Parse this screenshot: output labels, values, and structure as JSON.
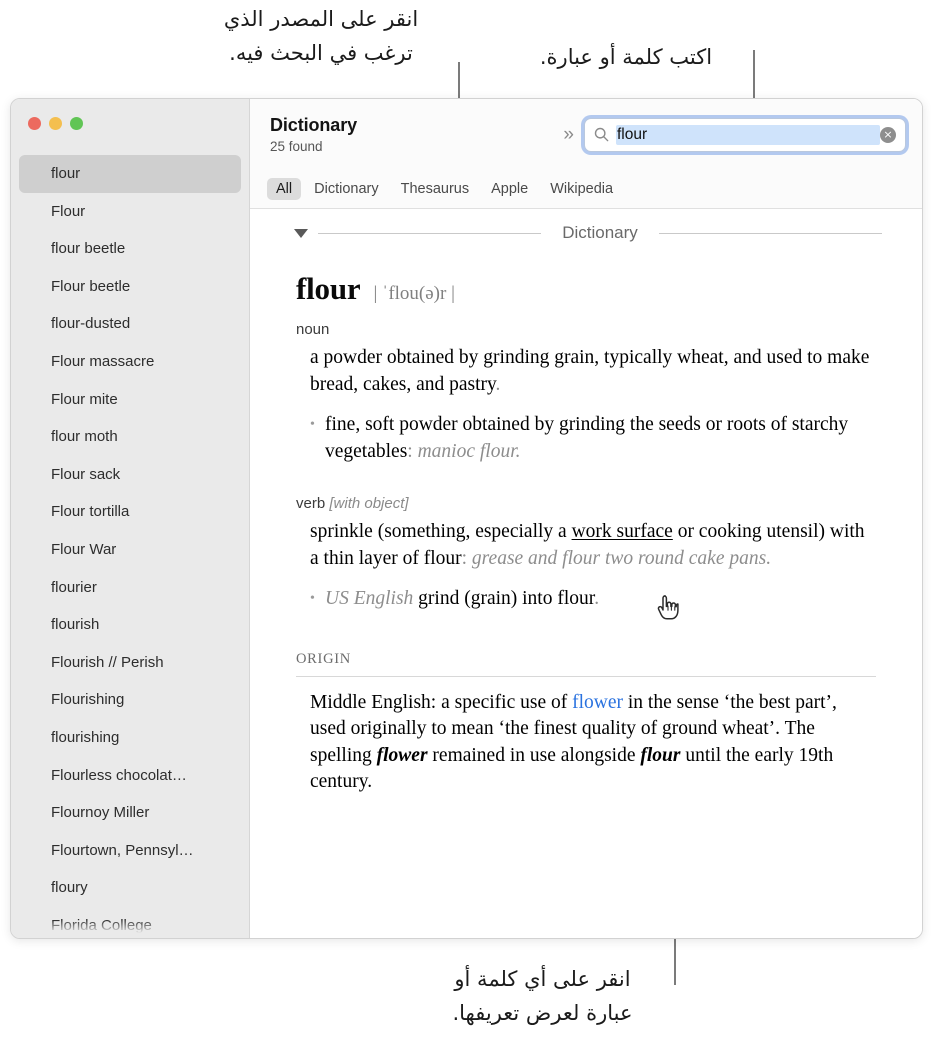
{
  "callouts": {
    "source": "انقر على المصدر الذي\nترغب في البحث فيه.",
    "type": "اكتب كلمة أو عبارة.",
    "click": "انقر على أي كلمة أو\nعبارة لعرض تعريفها."
  },
  "window": {
    "traffic_lights": {
      "close_label": "close-window",
      "minimize_label": "minimize-window",
      "maximize_label": "maximize-window",
      "close_color": "#EC6A5F",
      "minimize_color": "#F4BF4F",
      "maximize_color": "#61C555"
    }
  },
  "toolbar": {
    "app_title": "Dictionary",
    "found_count": "25 found",
    "overflow_chevrons": "»",
    "search": {
      "icon": "search-icon",
      "value": "flour",
      "placeholder": "Search",
      "clear_icon": "×",
      "selection_color": "#CFE3FB",
      "focus_ring_color": "#78A0E6"
    }
  },
  "tabs": [
    {
      "label": "All",
      "active": true
    },
    {
      "label": "Dictionary",
      "active": false
    },
    {
      "label": "Thesaurus",
      "active": false
    },
    {
      "label": "Apple",
      "active": false
    },
    {
      "label": "Wikipedia",
      "active": false
    }
  ],
  "sidebar": {
    "items": [
      {
        "label": "flour",
        "selected": true
      },
      {
        "label": "Flour",
        "selected": false
      },
      {
        "label": "flour beetle",
        "selected": false
      },
      {
        "label": "Flour beetle",
        "selected": false
      },
      {
        "label": "flour-dusted",
        "selected": false
      },
      {
        "label": "Flour massacre",
        "selected": false
      },
      {
        "label": "Flour mite",
        "selected": false
      },
      {
        "label": "flour moth",
        "selected": false
      },
      {
        "label": "Flour sack",
        "selected": false
      },
      {
        "label": "Flour tortilla",
        "selected": false
      },
      {
        "label": "Flour War",
        "selected": false
      },
      {
        "label": "flourier",
        "selected": false
      },
      {
        "label": "flourish",
        "selected": false
      },
      {
        "label": "Flourish // Perish",
        "selected": false
      },
      {
        "label": "Flourishing",
        "selected": false
      },
      {
        "label": "flourishing",
        "selected": false
      },
      {
        "label": "Flourless chocolat…",
        "selected": false
      },
      {
        "label": "Flournoy Miller",
        "selected": false
      },
      {
        "label": "Flourtown, Pennsyl…",
        "selected": false
      },
      {
        "label": "floury",
        "selected": false
      },
      {
        "label": "Florida College",
        "selected": false
      }
    ]
  },
  "article": {
    "section_title": "Dictionary",
    "headword": "flour",
    "pronunciation": "| ˈflou(ə)r |",
    "noun": {
      "pos": "noun",
      "sense_text": "a powder obtained by grinding grain, typically wheat, and used to make bread, cakes, and pastry",
      "sense_period": ".",
      "subsense_text": "fine, soft powder obtained by grinding the seeds or roots of starchy vegetables",
      "subsense_colon": ": ",
      "subsense_example": "manioc flour."
    },
    "verb": {
      "pos": "verb",
      "pos_note": "[with object]",
      "sense_pre": "sprinkle (something, especially a ",
      "sense_link": "work surface",
      "sense_post": " or cooking utensil) with a thin layer of flour",
      "sense_colon": ": ",
      "sense_example": "grease and flour two round cake pans.",
      "subsense_label": "US English ",
      "subsense_text": "grind (grain) into flour",
      "subsense_period": "."
    },
    "origin": {
      "label": "ORIGIN",
      "pre": "Middle English: a specific use of ",
      "link": "flower",
      "mid": " in the sense ‘the best part’, used originally to mean ‘the finest quality of ground wheat’. The spelling ",
      "bold1": "flower",
      "mid2": " remained in use alongside ",
      "bold2": "flour",
      "post": " until the early 19th century."
    }
  },
  "cursor": {
    "type": "pointing-hand-cursor"
  }
}
